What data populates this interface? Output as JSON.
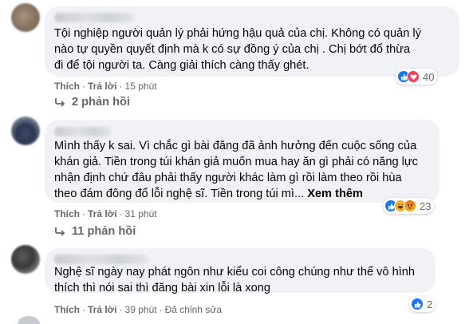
{
  "colors": {
    "like_blue": "#1877f2",
    "love_red": "#f33e58",
    "haha_yellow": "#f7b125",
    "angry_orange": "#e9710f",
    "secondary_text": "#65676b",
    "bubble_bg": "#f0f2f5"
  },
  "comments": [
    {
      "text_lines": [
        "Tội nghiệp người quản lý phải hứng hậu quả của chị. Không có quản lý",
        "nào tự quyền quyết định mà k có sự đồng ý của chị . Chị bớt đổ thừa",
        "đi để tội người ta. Càng giải thích càng thấy ghét."
      ],
      "reactions": [
        "like-icon",
        "love-icon"
      ],
      "reaction_count": "40",
      "like_label": "Thích",
      "reply_label": "Trả lời",
      "time": "15 phút",
      "replies_label": "2 phản hồi"
    },
    {
      "text_lines": [
        "Mình thấy k sai. Vì chắc gì bài đăng đã ảnh hưởng đến cuộc sống của",
        "khán giả. Tiền trong túi khán giả muốn mua hay ăn gì phải có năng lực",
        "nhận định chứ đâu phải thấy người khác làm gì rồi làm theo rồi hùa",
        "theo đám đông đổ lỗi nghệ sĩ. Tiền trong túi mì... "
      ],
      "see_more": "Xem thêm",
      "reactions": [
        "like-icon",
        "haha-icon",
        "angry-icon"
      ],
      "reaction_count": "23",
      "like_label": "Thích",
      "reply_label": "Trả lời",
      "time": "31 phút",
      "replies_label": "11 phản hồi"
    },
    {
      "text_lines": [
        "Nghệ sĩ ngày nay phát ngôn như kiểu coi công chúng như thể vô hình",
        "thích thì nói sai thì đăng bài xin lỗi là xong"
      ],
      "reactions": [
        "like-icon"
      ],
      "reaction_count": "2",
      "like_label": "Thích",
      "reply_label": "Trả lời",
      "time": "39 phút",
      "edited_label": "Đã chỉnh sửa"
    }
  ]
}
